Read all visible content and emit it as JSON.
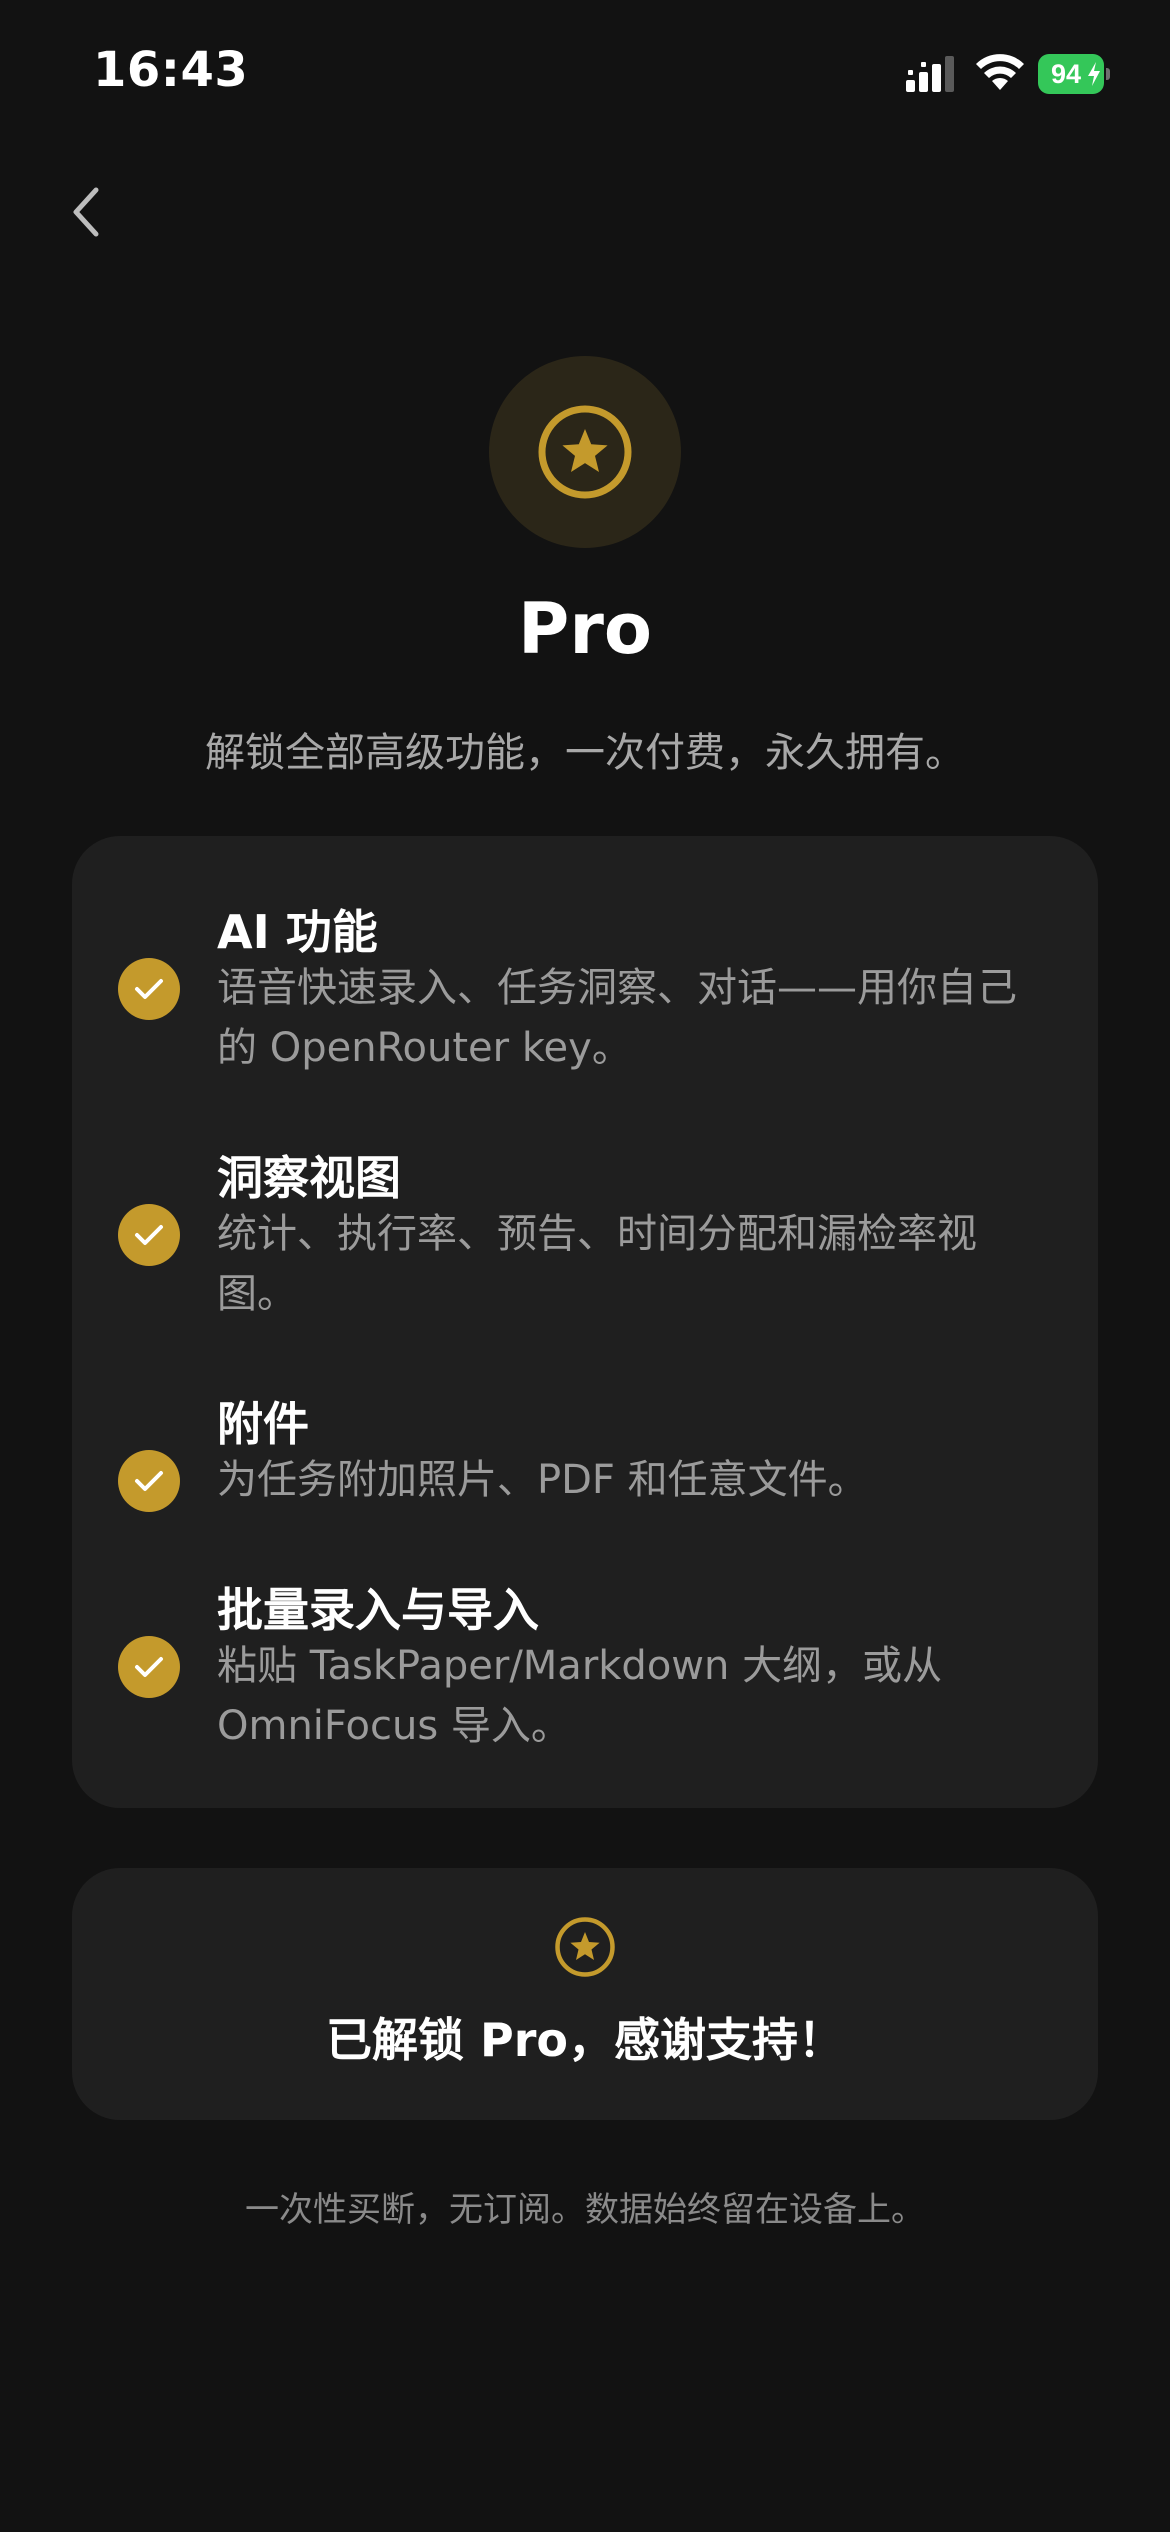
{
  "status_bar": {
    "time": "16:43",
    "battery": "94",
    "icons": [
      "signal-icon",
      "wifi-icon",
      "battery-charging-icon"
    ],
    "battery_color": "#34c759"
  },
  "nav": {
    "back_icon": "chevron-left-icon"
  },
  "hero": {
    "icon": "star-circle-icon",
    "title": "Pro",
    "subtitle": "解锁全部高级功能，一次付费，永久拥有。"
  },
  "features": [
    {
      "title": "AI 功能",
      "desc_lines": [
        "语音快速录入、任务洞察、对话——用你自己",
        "的 OpenRouter key。"
      ]
    },
    {
      "title": "洞察视图",
      "desc_lines": [
        "统计、执行率、预告、时间分配和漏检率视",
        "图。"
      ]
    },
    {
      "title": "附件",
      "desc_lines": [
        "为任务附加照片、PDF 和任意文件。"
      ]
    },
    {
      "title": "批量录入与导入",
      "desc_lines": [
        "粘贴 TaskPaper/Markdown 大纲，或从",
        "OmniFocus 导入。"
      ]
    }
  ],
  "unlocked": {
    "icon": "star-circle-icon",
    "text": "已解锁 Pro，感谢支持！"
  },
  "footer": "一次性买断，无订阅。数据始终留在设备上。",
  "colors": {
    "background": "#121212",
    "card": "#1f1f1f",
    "accent": "#c49a2c",
    "badge_bg": "#2b2618"
  }
}
